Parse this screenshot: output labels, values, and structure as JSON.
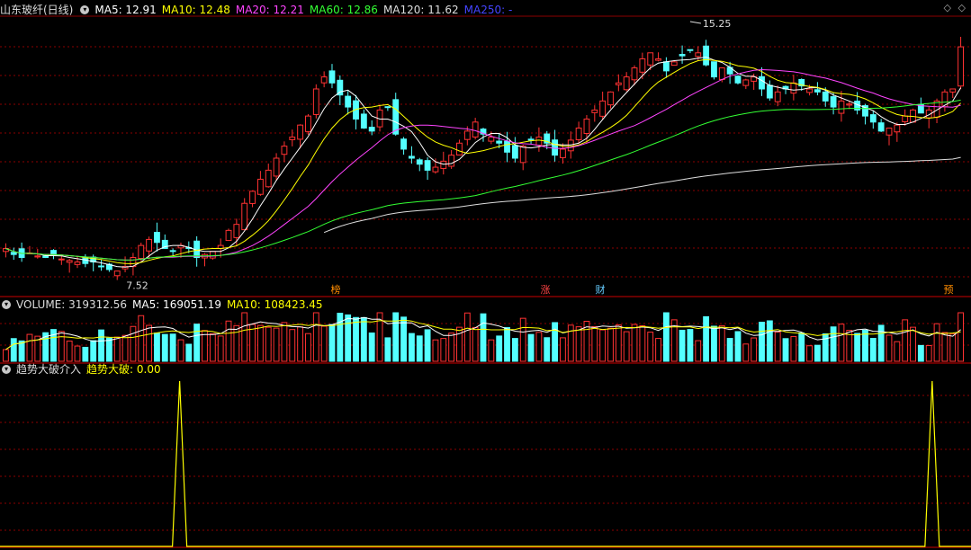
{
  "header": {
    "stock_title": "山东玻纤(日线)",
    "ma_labels": [
      {
        "text": "MA5: 12.91",
        "color": "#ffffff"
      },
      {
        "text": "MA10: 12.48",
        "color": "#ffff00"
      },
      {
        "text": "MA20: 12.21",
        "color": "#ff44ff"
      },
      {
        "text": "MA60: 12.86",
        "color": "#33ff33"
      },
      {
        "text": "MA120: 11.62",
        "color": "#dddddd"
      },
      {
        "text": "MA250: -",
        "color": "#4444ff"
      }
    ]
  },
  "volume_legend": {
    "title": "VOLUME: 319312.56",
    "ma5": "MA5: 169051.19",
    "ma10": "MA10: 108423.45"
  },
  "indicator_legend": {
    "title": "趋势大破介入",
    "series": "趋势大破: 0.00"
  },
  "colors": {
    "up": "#ff3232",
    "down": "#54ffff",
    "grid": "#8b0000"
  },
  "chart_data": {
    "type": "candlestick",
    "price_range": [
      7.0,
      15.6
    ],
    "annotations": {
      "high": "15.25",
      "low": "7.52"
    },
    "event_markers": [
      "榜",
      "涨",
      "财",
      "预"
    ],
    "closes": [
      8.3,
      8.1,
      8.0,
      8.15,
      8.05,
      8.0,
      8.1,
      7.95,
      7.9,
      7.85,
      7.8,
      7.85,
      7.7,
      7.6,
      7.55,
      7.7,
      8.0,
      8.4,
      8.6,
      8.5,
      8.3,
      8.2,
      8.4,
      8.3,
      8.0,
      8.1,
      8.2,
      8.4,
      8.9,
      9.1,
      9.8,
      10.2,
      10.6,
      10.9,
      11.3,
      11.7,
      12.0,
      12.4,
      12.7,
      13.6,
      14.0,
      13.8,
      13.4,
      13.0,
      12.6,
      12.3,
      12.2,
      12.9,
      13.0,
      12.1,
      11.6,
      11.3,
      11.1,
      10.9,
      11.0,
      11.2,
      11.4,
      11.8,
      12.2,
      12.5,
      12.1,
      12.0,
      11.8,
      11.5,
      11.3,
      11.7,
      11.9,
      12.0,
      11.8,
      11.4,
      11.6,
      11.9,
      12.3,
      12.6,
      12.9,
      13.2,
      13.5,
      13.8,
      14.0,
      14.3,
      14.6,
      14.8,
      14.6,
      14.2,
      14.5,
      14.7,
      14.9,
      14.8,
      14.4,
      14.0,
      14.3,
      14.1,
      13.8,
      13.9,
      14.0,
      13.6,
      13.3,
      13.5,
      13.6,
      13.8,
      13.7,
      13.6,
      13.5,
      13.2,
      13.0,
      13.2,
      13.1,
      12.9,
      12.7,
      12.5,
      12.2,
      12.3,
      12.4,
      12.7,
      12.9,
      12.8,
      12.9,
      13.2,
      13.5,
      13.6,
      15.0
    ],
    "volume_ma5": 169051.19,
    "volume_ma10": 108423.45,
    "indicator_signal_bars": [
      0.185,
      0.96
    ],
    "indicator_value": 0.0
  }
}
